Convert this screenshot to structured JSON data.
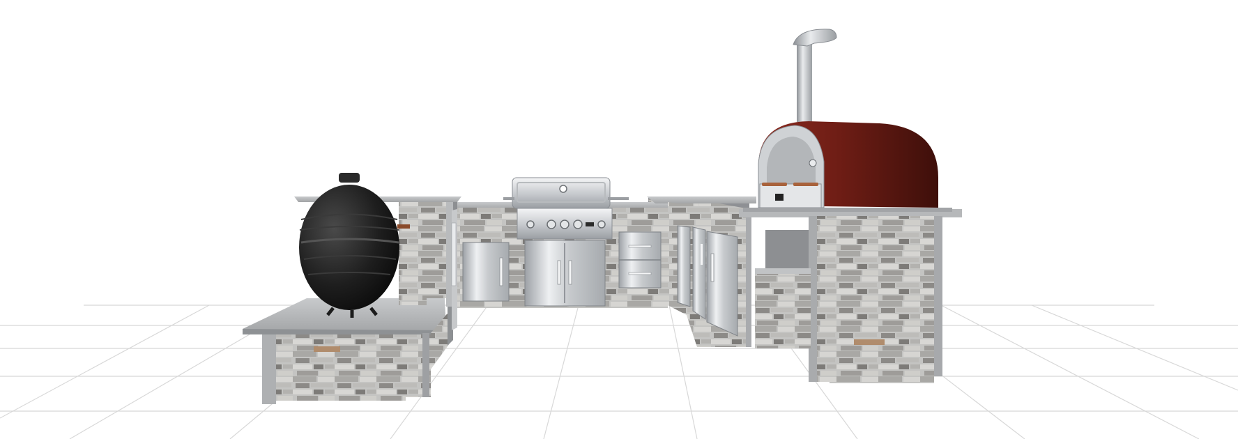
{
  "scene": {
    "colors": {
      "background": "#ffffff",
      "floor_grid": "#d8d8d8",
      "stone_light": "#c4c4c2",
      "stone_dark": "#7d7b78",
      "stone_accent": "#b08c6c",
      "counter": "#b7b9bb",
      "steel": "#d3d6d9",
      "steel_dark": "#8e9297",
      "kamado": "#1e1e1e",
      "oven_dome": "#6e1d15",
      "oven_handle": "#a8623b"
    }
  }
}
